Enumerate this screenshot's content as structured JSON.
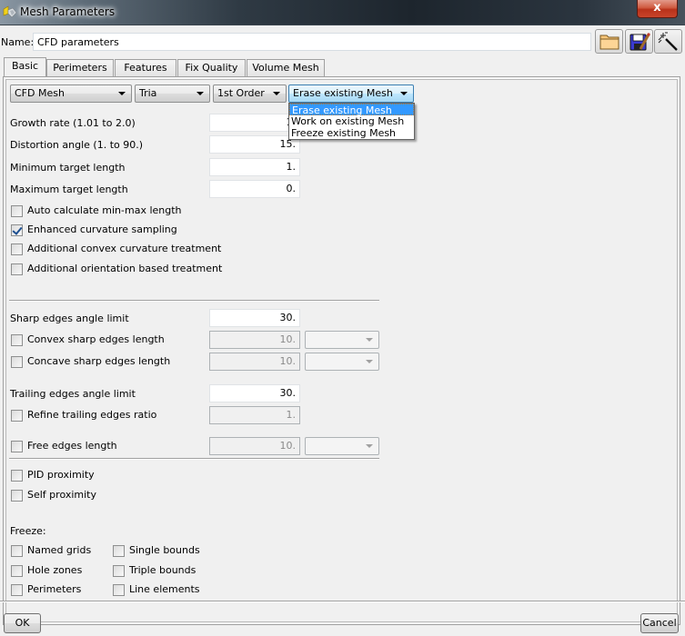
{
  "window": {
    "title": "Mesh Parameters",
    "close_label": "x"
  },
  "name_field": {
    "label": "Name:",
    "value": "CFD parameters"
  },
  "toolbar": {
    "open_icon": "folder-icon",
    "save_icon": "save-edit-icon",
    "wizard_icon": "magic-wand-icon"
  },
  "tabs": [
    {
      "label": "Basic",
      "active": true
    },
    {
      "label": "Perimeters",
      "active": false
    },
    {
      "label": "Features",
      "active": false
    },
    {
      "label": "Fix Quality",
      "active": false
    },
    {
      "label": "Volume Mesh",
      "active": false
    }
  ],
  "combos": {
    "mesh_type": "CFD Mesh",
    "element_type": "Tria",
    "order": "1st Order",
    "existing_mesh": "Erase existing Mesh"
  },
  "existing_mesh_options": [
    "Erase existing Mesh",
    "Work on existing Mesh",
    "Freeze existing Mesh"
  ],
  "fields": {
    "growth_rate": {
      "label": "Growth rate (1.01 to 2.0)",
      "value": "1."
    },
    "distortion_angle": {
      "label": "Distortion angle (1. to 90.)",
      "value": "15."
    },
    "min_target_length": {
      "label": "Minimum target length",
      "value": "1."
    },
    "max_target_length": {
      "label": "Maximum target length",
      "value": "0."
    }
  },
  "checkboxes_top": [
    {
      "label": "Auto calculate min-max length",
      "checked": false
    },
    {
      "label": "Enhanced curvature sampling",
      "checked": true
    },
    {
      "label": "Additional convex curvature treatment",
      "checked": false
    },
    {
      "label": "Additional orientation based treatment",
      "checked": false
    }
  ],
  "edges": {
    "sharp_angle": {
      "label": "Sharp edges angle limit",
      "value": "30."
    },
    "convex_sharp": {
      "label": "Convex sharp edges length",
      "value": "10.",
      "checked": false
    },
    "concave_sharp": {
      "label": "Concave sharp edges length",
      "value": "10.",
      "checked": false
    },
    "trailing_angle": {
      "label": "Trailing edges angle limit",
      "value": "30."
    },
    "refine_trailing": {
      "label": "Refine trailing edges ratio",
      "value": "1.",
      "checked": false
    },
    "free_edges": {
      "label": "Free edges length",
      "value": "10.",
      "checked": false
    }
  },
  "proximity": [
    {
      "label": "PID proximity",
      "checked": false
    },
    {
      "label": "Self proximity",
      "checked": false
    }
  ],
  "freeze": {
    "label": "Freeze:",
    "items": [
      {
        "label": "Named grids",
        "checked": false
      },
      {
        "label": "Hole zones",
        "checked": false
      },
      {
        "label": "Perimeters",
        "checked": false
      },
      {
        "label": "Single bounds",
        "checked": false
      },
      {
        "label": "Triple bounds",
        "checked": false
      },
      {
        "label": "Line elements",
        "checked": false
      }
    ]
  },
  "buttons": {
    "ok": "OK",
    "cancel": "Cancel"
  }
}
